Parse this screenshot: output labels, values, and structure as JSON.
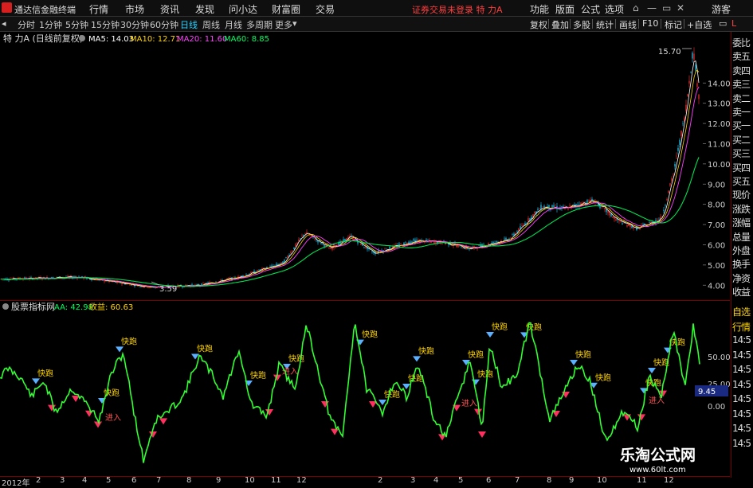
{
  "menubar": {
    "app_title": "通达信金融终端",
    "menus": [
      "行情",
      "市场",
      "资讯",
      "发现",
      "问小达",
      "财富圈",
      "交易"
    ],
    "login_status": "证券交易未登录 特 力A",
    "right_menus": [
      "功能",
      "版面",
      "公式",
      "选项"
    ],
    "guest": "游客"
  },
  "toolbar": {
    "periods": [
      "分时",
      "1分钟",
      "5分钟",
      "15分钟",
      "30分钟",
      "60分钟",
      "日线",
      "周线",
      "月线",
      "多周期",
      "更多"
    ],
    "active": "日线",
    "tools": [
      "复权",
      "叠加",
      "多股",
      "统计",
      "画线",
      "F10",
      "标记",
      "+自选"
    ]
  },
  "main_chart": {
    "stock_title": "特 力A (日线前复权)",
    "ma": [
      {
        "label": "MA5: 14.03",
        "color": "#ffffff"
      },
      {
        "label": "MA10: 12.71",
        "color": "#ffd400"
      },
      {
        "label": "MA20: 11.60",
        "color": "#ff40ff"
      },
      {
        "label": "MA60: 8.85",
        "color": "#00ff60"
      }
    ],
    "y_ticks": [
      "14.00",
      "13.00",
      "12.00",
      "11.00",
      "10.00",
      "9.00",
      "8.00",
      "7.00",
      "6.00",
      "5.00",
      "4.00"
    ],
    "high_label": "15.70",
    "low_label": "3.59"
  },
  "indicator": {
    "name": "股票指标网",
    "aa_label": "AA: 42.98",
    "profit_label": "收益: 60.63",
    "y_ticks": [
      "50.00",
      "25.00",
      "0.00"
    ],
    "current_value": "9.45",
    "signal_run": "快跑",
    "signal_in": "进入"
  },
  "right_panel": {
    "order_items": [
      "委比",
      "卖五",
      "卖四",
      "卖三",
      "卖二",
      "卖一",
      "买一",
      "买二",
      "买三",
      "买四",
      "买五",
      "现价",
      "涨跌",
      "涨幅",
      "总量",
      "外盘",
      "换手",
      "净资",
      "收益"
    ],
    "indicator_items": [
      "自选",
      "行情",
      "14:5",
      "14:5",
      "14:5",
      "14:5",
      "14:5",
      "14:5",
      "14:5",
      "14:5"
    ]
  },
  "time_axis": {
    "labels": [
      "2012年",
      "2",
      "3",
      "4",
      "5",
      "6",
      "7",
      "8",
      "9",
      "10",
      "11",
      "12",
      "2",
      "3",
      "4",
      "5",
      "6",
      "7",
      "8",
      "9",
      "10",
      "11",
      "12"
    ]
  },
  "watermark": {
    "cn": "乐淘公式网",
    "url": "www.60lt.com"
  }
}
